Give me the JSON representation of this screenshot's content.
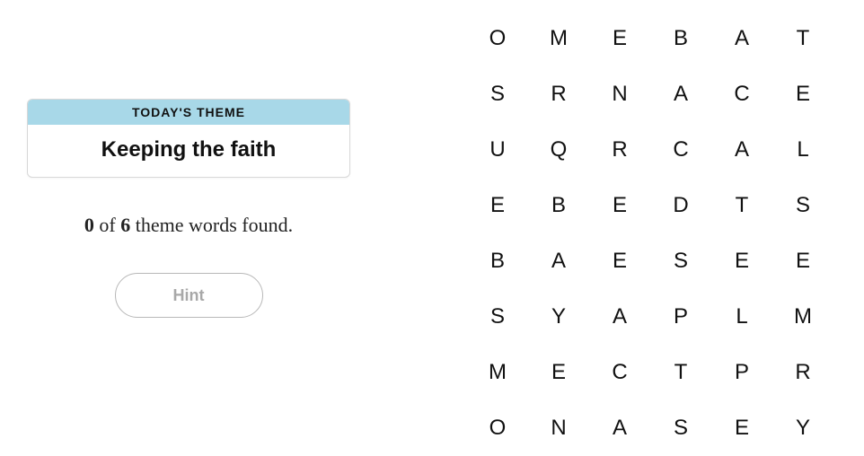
{
  "theme": {
    "header_label": "TODAY'S THEME",
    "title": "Keeping the faith"
  },
  "progress": {
    "found": "0",
    "of_word": "of",
    "total": "6",
    "suffix": "theme words found."
  },
  "hint": {
    "label": "Hint"
  },
  "grid": {
    "rows": [
      [
        "O",
        "M",
        "E",
        "B",
        "A",
        "T"
      ],
      [
        "S",
        "R",
        "N",
        "A",
        "C",
        "E"
      ],
      [
        "U",
        "Q",
        "R",
        "C",
        "A",
        "L"
      ],
      [
        "E",
        "B",
        "E",
        "D",
        "T",
        "S"
      ],
      [
        "B",
        "A",
        "E",
        "S",
        "E",
        "E"
      ],
      [
        "S",
        "Y",
        "A",
        "P",
        "L",
        "M"
      ],
      [
        "M",
        "E",
        "C",
        "T",
        "P",
        "R"
      ],
      [
        "O",
        "N",
        "A",
        "S",
        "E",
        "Y"
      ]
    ]
  }
}
